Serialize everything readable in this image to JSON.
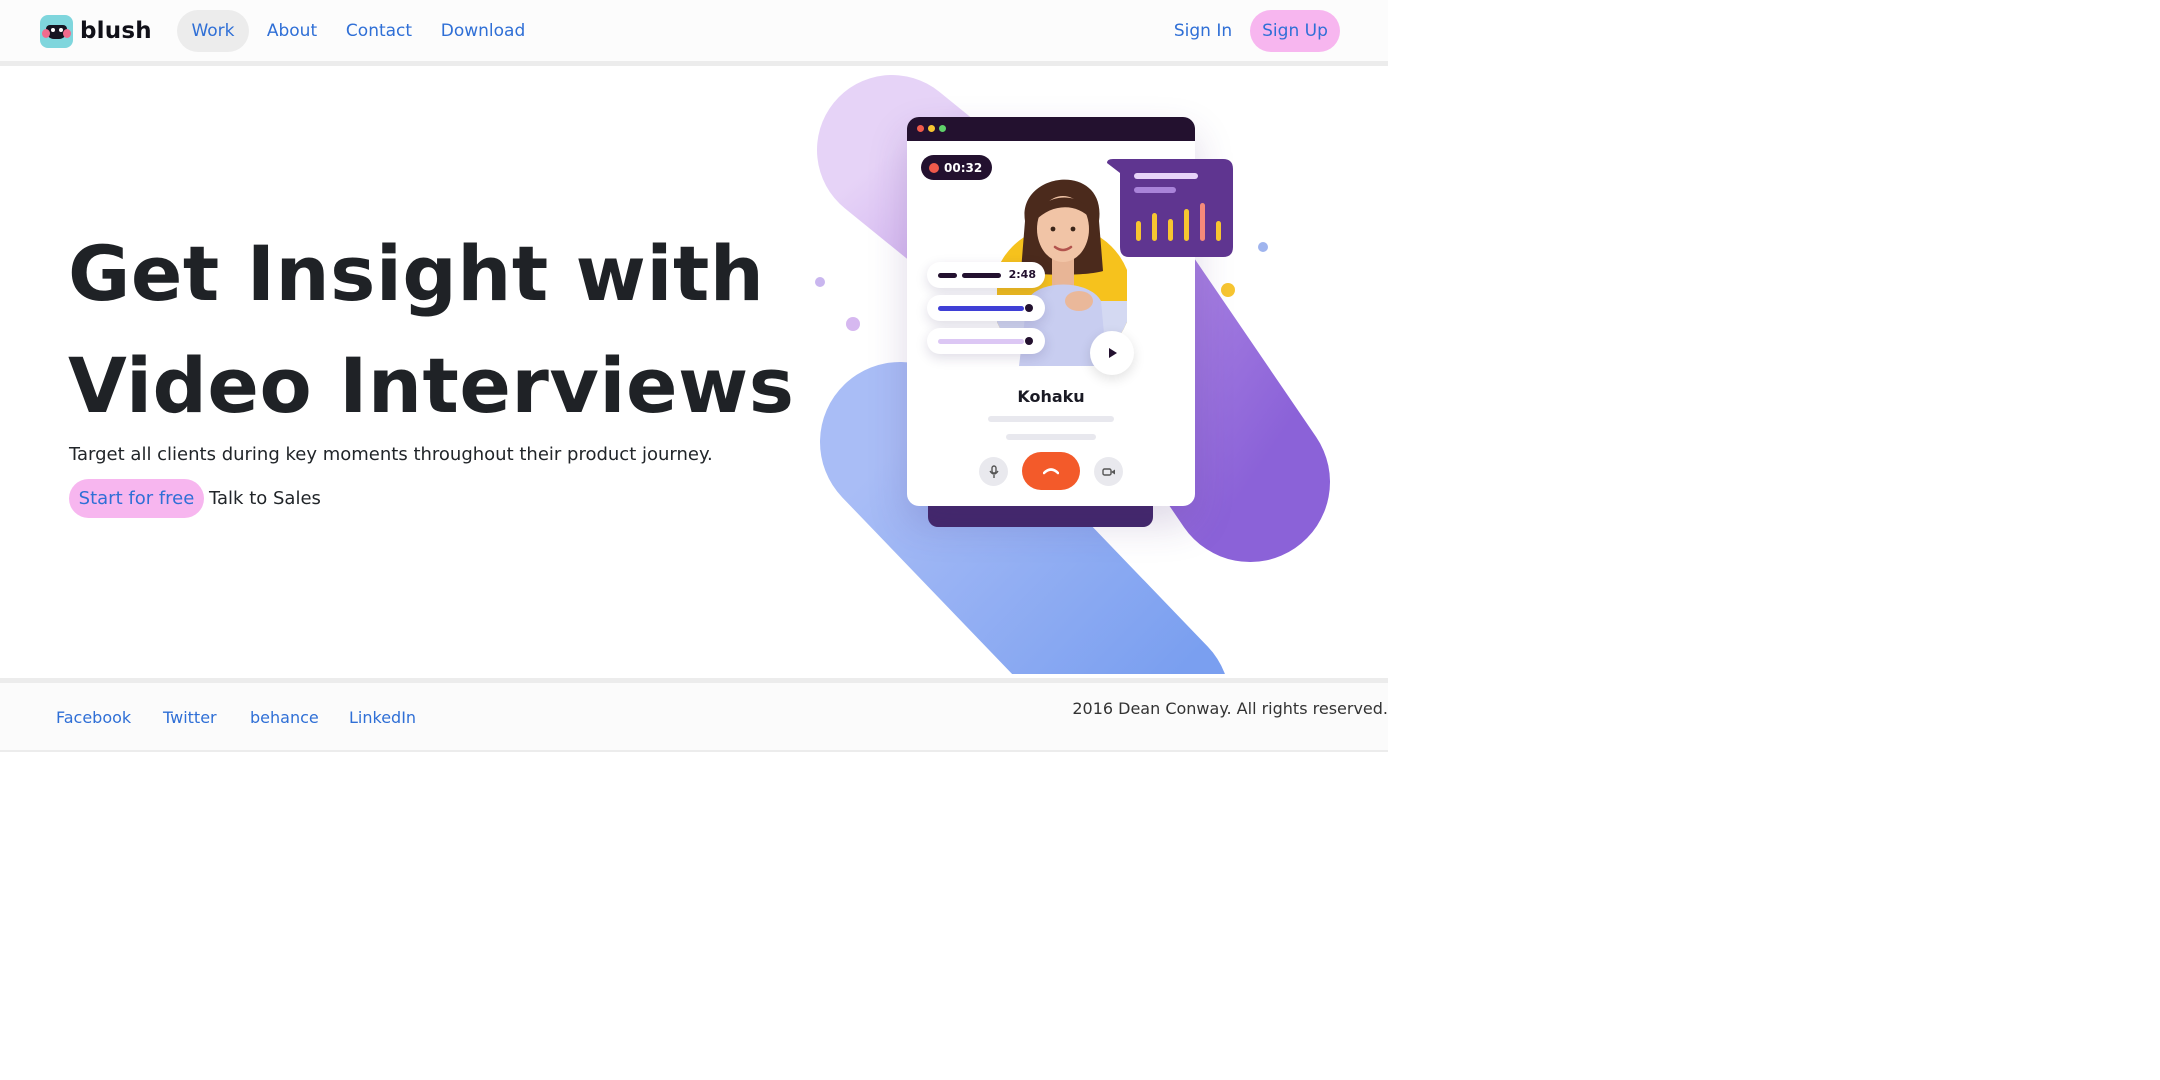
{
  "nav": {
    "brand": "blush",
    "links": [
      {
        "label": "Work",
        "active": true
      },
      {
        "label": "About",
        "active": false
      },
      {
        "label": "Contact",
        "active": false
      },
      {
        "label": "Download",
        "active": false
      }
    ],
    "sign_in": "Sign In",
    "sign_up": "Sign Up"
  },
  "hero": {
    "title_line1": "Get Insight with",
    "title_line2": "Video Interviews",
    "subtitle": "Target all clients during key moments throughout their product journey.",
    "cta_primary": "Start for free",
    "cta_secondary": "Talk to Sales"
  },
  "illustration": {
    "recording_time": "00:32",
    "clip_time": "2:48",
    "person_name": "Kohaku",
    "icons": [
      "record-icon",
      "play-icon",
      "microphone-icon",
      "end-call-icon",
      "camera-icon",
      "bar-chart-icon"
    ]
  },
  "footer": {
    "links": [
      "Facebook",
      "Twitter",
      "behance",
      "LinkedIn"
    ],
    "copyright": "2016 Dean Conway. All rights reserved."
  },
  "colors": {
    "accent_pink": "#f7b6ef",
    "link_blue": "#2f6fd6",
    "dark_purple": "#23112f",
    "end_call": "#f35a2a"
  }
}
